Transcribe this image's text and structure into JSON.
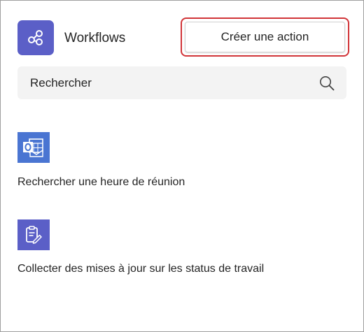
{
  "header": {
    "app_icon": "workflows-share-icon",
    "app_icon_color": "#5b5fc7",
    "title": "Workflows",
    "create_button_label": "Créer une action",
    "highlight_color": "#d13438"
  },
  "search": {
    "placeholder": "Rechercher",
    "icon": "search-icon"
  },
  "workflows": [
    {
      "label": "Rechercher une heure de réunion",
      "icon": "outlook-calendar-icon",
      "icon_color": "#4a75d2"
    },
    {
      "label": "Collecter des mises à jour sur les status de travail",
      "icon": "clipboard-edit-icon",
      "icon_color": "#5b5fc7"
    }
  ]
}
